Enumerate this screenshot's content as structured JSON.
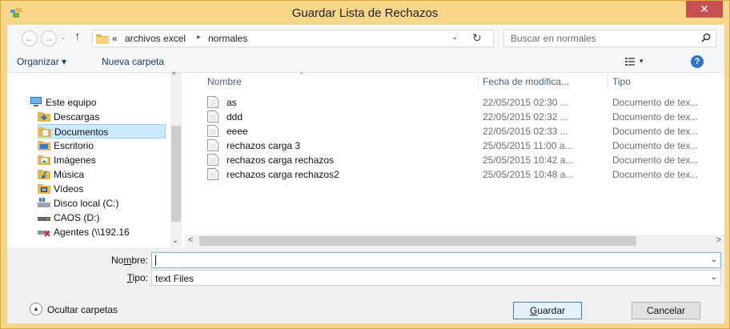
{
  "window": {
    "title": "Guardar Lista de Rechazos",
    "close_glyph": "✕"
  },
  "address": {
    "back_glyph": "←",
    "forward_glyph": "→",
    "drop_glyph": "⌄",
    "up_glyph": "↑",
    "overflow": "«",
    "crumbs": [
      "archivos excel",
      "normales"
    ],
    "separator": "▸",
    "dropdown_glyph": "⌄",
    "refresh_glyph": "↻"
  },
  "search": {
    "placeholder": "Buscar en normales"
  },
  "toolbar": {
    "organize": "Organizar ▾",
    "new_folder": "Nueva carpeta",
    "view_drop": "▾",
    "help": "?"
  },
  "nav": {
    "items": [
      {
        "label": "Este equipo",
        "icon": "computer-icon"
      },
      {
        "label": "Descargas",
        "icon": "downloads-folder-icon"
      },
      {
        "label": "Documentos",
        "icon": "documents-folder-icon",
        "selected": true
      },
      {
        "label": "Escritorio",
        "icon": "desktop-folder-icon"
      },
      {
        "label": "Imágenes",
        "icon": "pictures-folder-icon"
      },
      {
        "label": "Música",
        "icon": "music-folder-icon"
      },
      {
        "label": "Vídeos",
        "icon": "videos-folder-icon"
      },
      {
        "label": "Disco local (C:)",
        "icon": "local-disk-icon"
      },
      {
        "label": "CAOS (D:)",
        "icon": "drive-icon"
      },
      {
        "label": "Agentes (\\\\192.16",
        "icon": "network-drive-disconnected-icon"
      }
    ],
    "scroll_up": "^",
    "scroll_down": "⌄"
  },
  "files": {
    "columns": {
      "name": "Nombre",
      "date": "Fecha de modifica...",
      "type": "Tipo"
    },
    "sort_caret": "^",
    "rows": [
      {
        "name": "as",
        "date": "22/05/2015 02:30 ...",
        "type": "Documento de tex..."
      },
      {
        "name": "ddd",
        "date": "22/05/2015 02:32 ...",
        "type": "Documento de tex..."
      },
      {
        "name": "eeee",
        "date": "22/05/2015 02:33 ...",
        "type": "Documento de tex..."
      },
      {
        "name": "rechazos carga 3",
        "date": "25/05/2015 11:00 a...",
        "type": "Documento de tex..."
      },
      {
        "name": "rechazos carga rechazos",
        "date": "25/05/2015 10:42 a...",
        "type": "Documento de tex..."
      },
      {
        "name": "rechazos carga rechazos2",
        "date": "25/05/2015 10:48 a...",
        "type": "Documento de tex..."
      }
    ],
    "hscroll_left": "<",
    "hscroll_right": ">"
  },
  "form": {
    "name_label_pre": "No",
    "name_label_u": "m",
    "name_label_post": "bre:",
    "name_value": "",
    "type_label_u": "T",
    "type_label_post": "ipo:",
    "type_value": "text Files",
    "dropdown_glyph": "⌄"
  },
  "footer": {
    "hide_folders": "Ocultar carpetas",
    "hide_glyph": "▲",
    "save_u": "G",
    "save_post": "uardar",
    "cancel": "Cancelar"
  },
  "colors": {
    "titlebar": "#f7d68a",
    "close": "#c75050",
    "selection": "#cce8ff"
  }
}
